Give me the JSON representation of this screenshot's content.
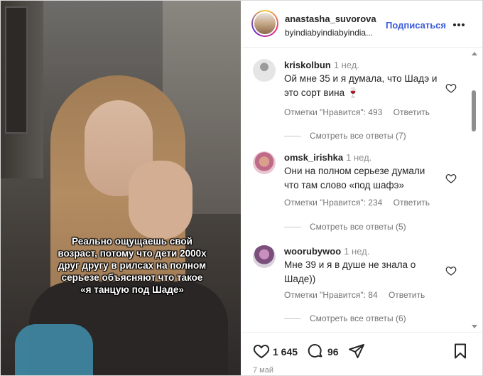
{
  "media": {
    "caption_lines": [
      "Реально ощущаешь свой",
      "возраст, потому что дети 2000х",
      "друг другу в рилсах на полном",
      "серьезе объясняют что такое",
      "«я танцую под Шаде»"
    ]
  },
  "header": {
    "username": "anastasha_suvorova",
    "subtitle": "byindiabyindiabyindia...",
    "follow_label": "Подписаться",
    "more_icon": "more-horizontal-icon"
  },
  "comments": [
    {
      "username": "kriskolbun",
      "time": "1 нед.",
      "text": "Ой мне 35 и я думала, что Шадэ и это сорт вина 🍷",
      "likes_label": "Отметки \"Нравится\": 493",
      "reply_label": "Ответить",
      "replies_label": "Смотреть все ответы (7)"
    },
    {
      "username": "omsk_irishka",
      "time": "1 нед.",
      "text": "Они на полном серьезе думали что там слово «под шафэ»",
      "likes_label": "Отметки \"Нравится\": 234",
      "reply_label": "Ответить",
      "replies_label": "Смотреть все ответы (5)"
    },
    {
      "username": "woorubywoo",
      "time": "1 нед.",
      "text": "Мне 39 и я в душе не знала о Шаде))",
      "likes_label": "Отметки \"Нравится\": 84",
      "reply_label": "Ответить",
      "replies_label": "Смотреть все ответы (6)"
    }
  ],
  "actions": {
    "like_count": "1 645",
    "comment_count": "96",
    "date": "7 май"
  },
  "colors": {
    "accent": "#3b5bdb",
    "text": "#262626",
    "muted": "#737373"
  }
}
